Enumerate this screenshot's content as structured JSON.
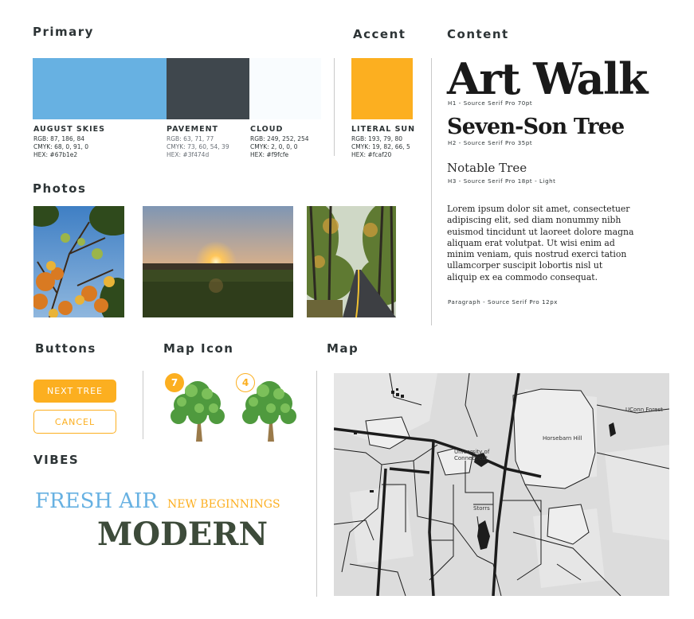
{
  "sections": {
    "primary": "Primary",
    "accent": "Accent",
    "content": "Content",
    "photos": "Photos",
    "buttons": "Buttons",
    "map_icon": "Map Icon",
    "map": "Map",
    "vibes": "VIBES"
  },
  "colors": {
    "august_skies": "#67b1e2",
    "pavement": "#3f474d",
    "cloud": "#f9fcfe",
    "literal_sun": "#fcaf20"
  },
  "swatches": [
    {
      "name": "AUGUST SKIES",
      "rgb": "RGB: 87, 186, 84",
      "cmyk": "CMYK: 68, 0, 91, 0",
      "hex": "HEX: #67b1e2"
    },
    {
      "name": "PAVEMENT",
      "rgb": "RGB: 63, 71, 77",
      "cmyk": "CMYK: 73, 60, 54, 39",
      "hex": "HEX: #3f474d"
    },
    {
      "name": "CLOUD",
      "rgb": "RGB: 249, 252, 254",
      "cmyk": "CMYK: 2, 0, 0, 0",
      "hex": "HEX: #f9fcfe"
    },
    {
      "name": "LITERAL SUN",
      "rgb": "RGB: 193, 79, 80",
      "cmyk": "CMYK: 19, 82, 66, 5",
      "hex": "HEX: #fcaf20"
    }
  ],
  "content": {
    "h1": "Art Walk",
    "h1_spec": "H1 - Source Serif Pro 70pt",
    "h2": "Seven-Son Tree",
    "h2_spec": "H2 - Source Serif Pro 35pt",
    "h3": "Notable Tree",
    "h3_spec": "H3 - Source Serif Pro 18pt - Light",
    "paragraph_lines": [
      "Lorem ipsum dolor sit amet, consectetuer",
      "adipiscing elit, sed diam nonummy nibh",
      "euismod tincidunt ut laoreet dolore magna",
      "aliquam erat volutpat. Ut wisi enim ad",
      "minim veniam, quis nostrud exerci tation",
      "ullamcorper suscipit lobortis nisl ut",
      "aliquip ex ea commodo consequat."
    ],
    "paragraph_spec": "Paragraph - Source Serif Pro 12px"
  },
  "buttons": {
    "next": "NEXT TREE",
    "cancel": "CANCEL"
  },
  "map_icons": [
    {
      "number": "7",
      "style": "filled",
      "icon": "tree-icon"
    },
    {
      "number": "4",
      "style": "outlined",
      "icon": "tree-icon"
    }
  ],
  "map": {
    "labels": {
      "uconn_forest": "UConn Forest",
      "horsebarn_hill": "Horsebarn Hill",
      "university_line1": "University of",
      "university_line2": "Connecticut",
      "storrs": "Storrs"
    }
  },
  "vibes": {
    "fresh_air": "FRESH AIR",
    "new_beginnings": "NEW BEGINNINGS",
    "modern": "MODERN"
  }
}
